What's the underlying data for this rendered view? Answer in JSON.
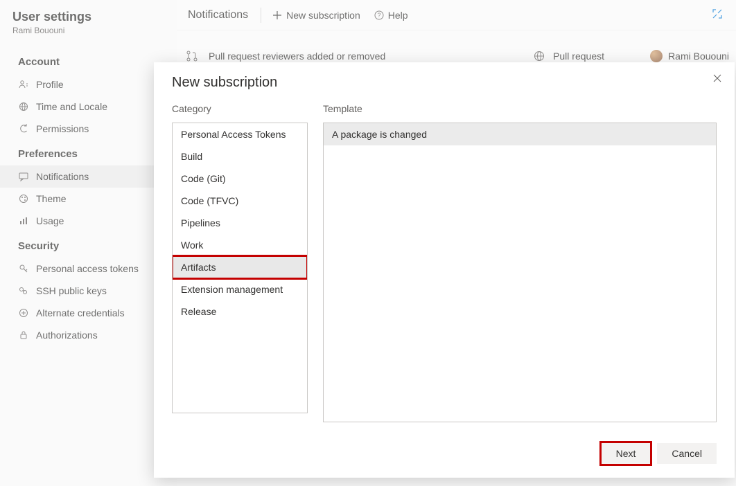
{
  "sidebar": {
    "title": "User settings",
    "user": "Rami Bououni",
    "groups": [
      {
        "label": "Account",
        "items": [
          {
            "id": "profile",
            "label": "Profile",
            "icon": "person"
          },
          {
            "id": "time",
            "label": "Time and Locale",
            "icon": "globe"
          },
          {
            "id": "perm",
            "label": "Permissions",
            "icon": "refresh"
          }
        ]
      },
      {
        "label": "Preferences",
        "items": [
          {
            "id": "notif",
            "label": "Notifications",
            "icon": "chat",
            "selected": true
          },
          {
            "id": "theme",
            "label": "Theme",
            "icon": "paint"
          },
          {
            "id": "usage",
            "label": "Usage",
            "icon": "bars"
          }
        ]
      },
      {
        "label": "Security",
        "items": [
          {
            "id": "pat",
            "label": "Personal access tokens",
            "icon": "key"
          },
          {
            "id": "ssh",
            "label": "SSH public keys",
            "icon": "keychain"
          },
          {
            "id": "alt",
            "label": "Alternate credentials",
            "icon": "idcred"
          },
          {
            "id": "auth",
            "label": "Authorizations",
            "icon": "lock"
          }
        ]
      }
    ]
  },
  "toolbar": {
    "title": "Notifications",
    "new_label": "New subscription",
    "help_label": "Help"
  },
  "row": {
    "title": "Pull request reviewers added or removed",
    "type": "Pull request",
    "user": "Rami Bououni"
  },
  "modal": {
    "title": "New subscription",
    "category_label": "Category",
    "template_label": "Template",
    "categories": [
      "Personal Access Tokens",
      "Build",
      "Code (Git)",
      "Code (TFVC)",
      "Pipelines",
      "Work",
      "Artifacts",
      "Extension management",
      "Release"
    ],
    "selected_category": "Artifacts",
    "templates": [
      "A package is changed"
    ],
    "selected_template": "A package is changed",
    "next_label": "Next",
    "cancel_label": "Cancel"
  }
}
